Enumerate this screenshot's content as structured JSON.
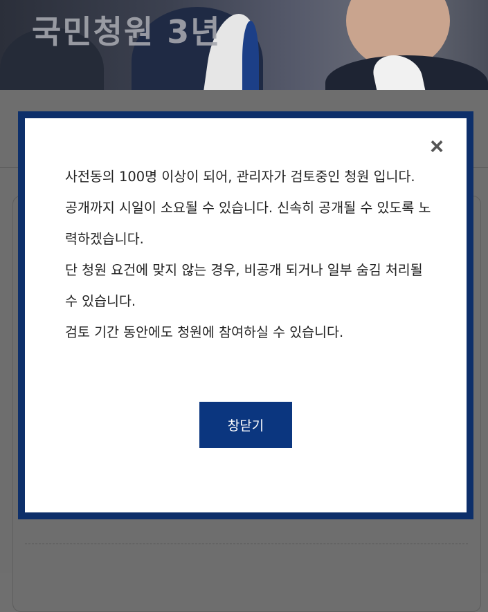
{
  "header": {
    "title": "국민청원 3년"
  },
  "modal": {
    "close_icon": "×",
    "paragraphs": [
      "사전동의 100명 이상이 되어, 관리자가 검토중인 청원 입니다.",
      "공개까지 시일이 소요될 수 있습니다. 신속히 공개될 수 있도록 노력하겠습니다.",
      "단 청원 요건에 맞지 않는 경우, 비공개 되거나 일부 숨김 처리될 수 있습니다.",
      "검토 기간 동안에도 청원에 참여하실 수 있습니다."
    ],
    "confirm_label": "창닫기"
  },
  "colors": {
    "frame": "#0d2f6a",
    "button": "#0b367f",
    "overlay": "#6e6e6e"
  }
}
